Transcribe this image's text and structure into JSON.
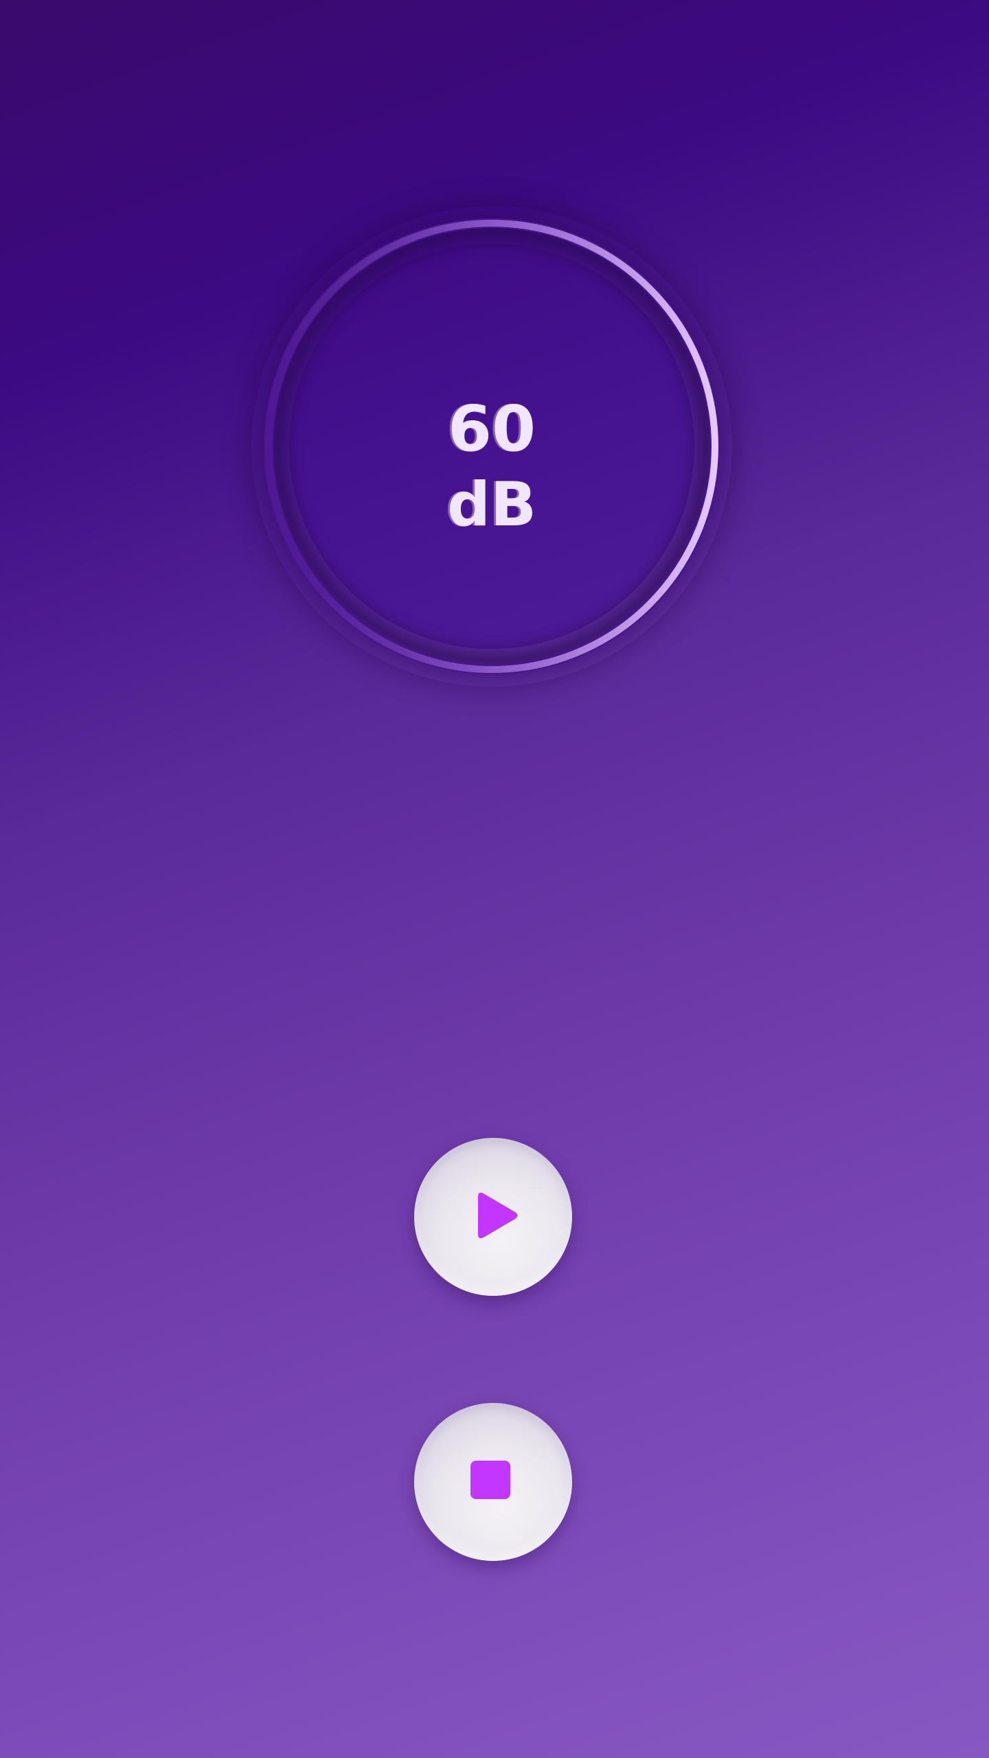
{
  "meter": {
    "value": "60",
    "unit": "dB",
    "ring_color": "#d7b4ff"
  },
  "controls": {
    "play_icon": "play-icon",
    "stop_icon": "stop-icon",
    "accent_color": "#c236ff"
  },
  "theme": {
    "background_top": "#3c0a82",
    "background_bottom": "#8758c2"
  }
}
